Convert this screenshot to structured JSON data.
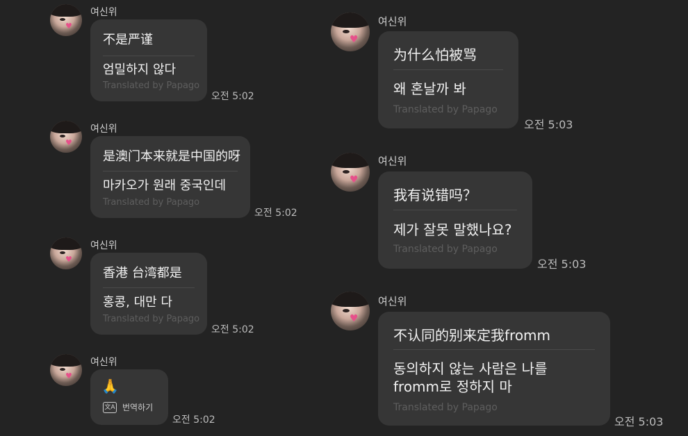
{
  "sender": "여신위",
  "translated_by": "Translated by Papago",
  "left_messages": [
    {
      "zh": "不是严谨",
      "ko": "엄밀하지 않다",
      "time": "오전 5:02"
    },
    {
      "zh": "是澳门本来就是中国的呀",
      "ko": "마카오가 원래 중국인데",
      "time": "오전 5:02"
    },
    {
      "zh": "香港 台湾都是",
      "ko": "홍콩, 대만 다",
      "time": "오전 5:02"
    },
    {
      "emoji": "🙏",
      "translate_label": "번역하기",
      "time": "오전 5:02"
    }
  ],
  "right_messages": [
    {
      "zh": "为什么怕被骂",
      "ko": "왜 혼날까 봐",
      "time": "오전 5:03"
    },
    {
      "zh": "我有说错吗？",
      "ko": "제가 잘못 말했나요?",
      "time": "오전 5:03"
    },
    {
      "zh": "不认同的别来定我fromm",
      "ko_line1": "동의하지 않는 사람은 나를",
      "ko_line2": "fromm로 정하지 마",
      "time": "오전 5:03"
    }
  ],
  "colors": {
    "background": "#232323",
    "bubble": "#363636",
    "translated_hint": "#5e5e5e",
    "heart": "#e6508a"
  },
  "icons": [
    "avatar",
    "translate-icon",
    "pray-emoji"
  ]
}
